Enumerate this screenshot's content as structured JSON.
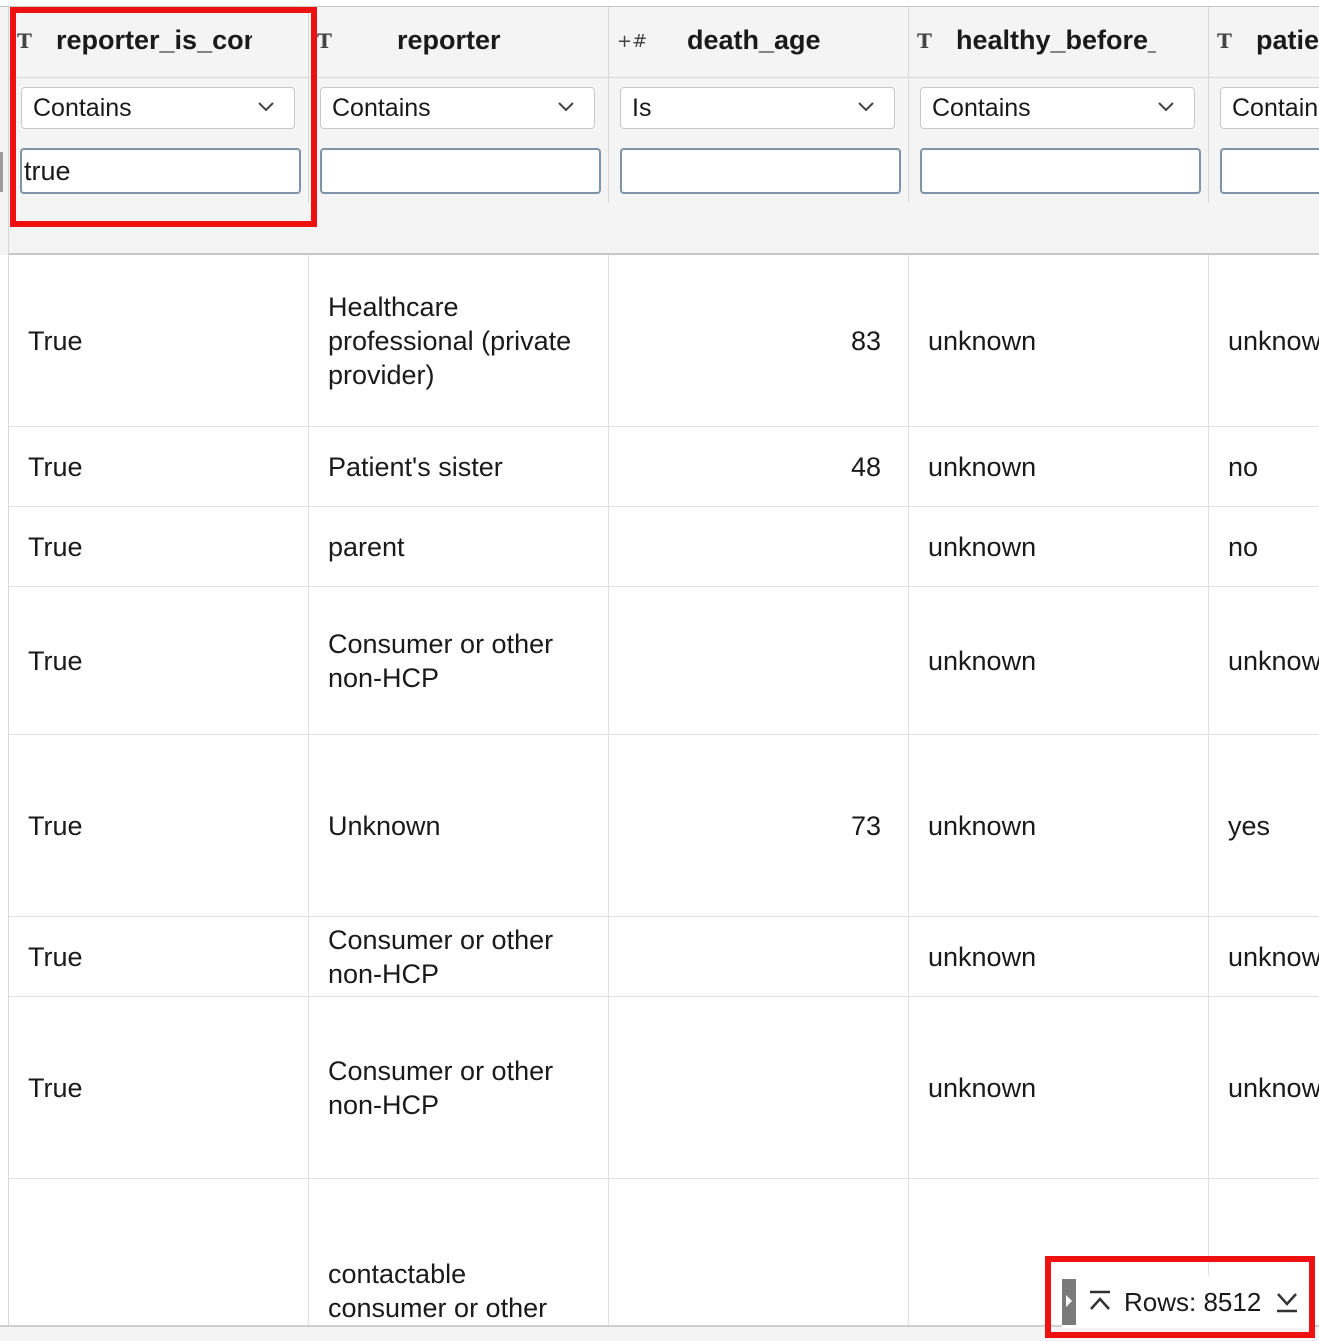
{
  "columns": [
    {
      "type_icon": "T",
      "title": "reporter_is_con",
      "filter_op": "Contains",
      "filter_value": "true"
    },
    {
      "type_icon": "T",
      "title": "reporter",
      "filter_op": "Contains",
      "filter_value": ""
    },
    {
      "type_icon": "+#",
      "title": "death_age",
      "filter_op": "Is",
      "filter_value": ""
    },
    {
      "type_icon": "T",
      "title": "healthy_before_",
      "filter_op": "Contains",
      "filter_value": ""
    },
    {
      "type_icon": "T",
      "title": "patie",
      "filter_op": "Contain",
      "filter_value": ""
    }
  ],
  "rows": [
    {
      "reporter_is_con": "True",
      "reporter": "Healthcare professional (private provider)",
      "death_age": "83",
      "healthy_before": "unknown",
      "patie": "unknow"
    },
    {
      "reporter_is_con": "True",
      "reporter": "Patient's sister",
      "death_age": "48",
      "healthy_before": "unknown",
      "patie": "no"
    },
    {
      "reporter_is_con": "True",
      "reporter": "parent",
      "death_age": "",
      "healthy_before": "unknown",
      "patie": "no"
    },
    {
      "reporter_is_con": "True",
      "reporter": "Consumer or other non-HCP",
      "death_age": "",
      "healthy_before": "unknown",
      "patie": "unknow"
    },
    {
      "reporter_is_con": "True",
      "reporter": "Unknown",
      "death_age": "73",
      "healthy_before": "unknown",
      "patie": "yes"
    },
    {
      "reporter_is_con": "True",
      "reporter": "Consumer or other non-HCP",
      "death_age": "",
      "healthy_before": "unknown",
      "patie": "unknow"
    },
    {
      "reporter_is_con": "True",
      "reporter": "Consumer or other non-HCP",
      "death_age": "",
      "healthy_before": "unknown",
      "patie": "unknow"
    },
    {
      "reporter_is_con": "",
      "reporter": "contactable consumer or other",
      "death_age": "",
      "healthy_before": "",
      "patie": ""
    }
  ],
  "footer": {
    "rows_label": "Rows: 8512"
  },
  "icons": {
    "scroll_top": "chevron-up-bar-icon",
    "scroll_bottom": "chevron-down-bar-icon",
    "dropdown": "chevron-down-icon"
  },
  "colors": {
    "highlight": "#ee1111",
    "header_bg": "#f4f4f4",
    "input_border": "#7f93a8"
  }
}
